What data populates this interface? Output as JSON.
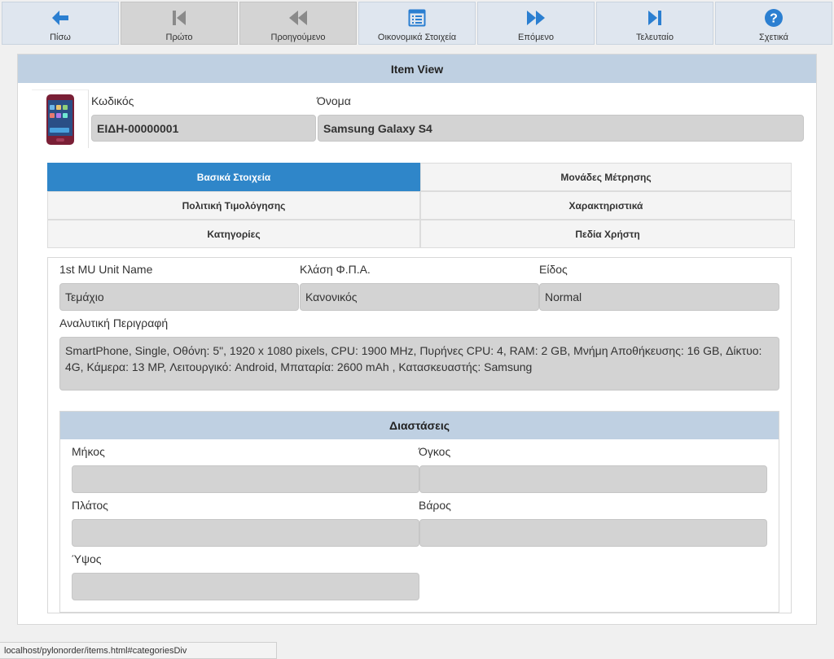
{
  "toolbar": {
    "buttons": [
      {
        "label": "Πίσω",
        "icon": "arrow-left-icon",
        "disabled": false
      },
      {
        "label": "Πρώτο",
        "icon": "skip-first-icon",
        "disabled": true
      },
      {
        "label": "Προηγούμενο",
        "icon": "rewind-icon",
        "disabled": true
      },
      {
        "label": "Οικονομικά Στοιχεία",
        "icon": "document-list-icon",
        "disabled": false
      },
      {
        "label": "Επόμενο",
        "icon": "fast-forward-icon",
        "disabled": false
      },
      {
        "label": "Τελευταίο",
        "icon": "skip-last-icon",
        "disabled": false
      },
      {
        "label": "Σχετικά",
        "icon": "help-icon",
        "disabled": false
      }
    ]
  },
  "panel": {
    "title": "Item View",
    "code_label": "Κωδικός",
    "code_value": "ΕΙΔΗ-00000001",
    "name_label": "Όνομα",
    "name_value": "Samsung Galaxy S4"
  },
  "tabs": [
    {
      "label": "Βασικά Στοιχεία",
      "active": true
    },
    {
      "label": "Μονάδες Μέτρησης",
      "active": false
    },
    {
      "label": "Πολιτική Τιμολόγησης",
      "active": false
    },
    {
      "label": "Χαρακτηριστικά",
      "active": false
    },
    {
      "label": "Κατηγορίες",
      "active": false
    },
    {
      "label": "Πεδία Χρήστη",
      "active": false
    }
  ],
  "basic": {
    "mu_label": "1st MU Unit Name",
    "mu_value": "Τεμάχιο",
    "vat_label": "Κλάση Φ.Π.Α.",
    "vat_value": "Κανονικός",
    "type_label": "Είδος",
    "type_value": "Normal",
    "desc_label": "Αναλυτική Περιγραφή",
    "desc_value": "SmartPhone, Single, Οθόνη: 5\", 1920 x 1080 pixels, CPU: 1900 MHz, Πυρήνες CPU: 4, RAM: 2 GB, Μνήμη Αποθήκευσης: 16 GB, Δίκτυο: 4G, Κάμερα: 13 MP, Λειτουργικό: Android, Μπαταρία: 2600 mAh , Κατασκευαστής: Samsung"
  },
  "dimensions": {
    "title": "Διαστάσεις",
    "length_label": "Μήκος",
    "volume_label": "Όγκος",
    "width_label": "Πλάτος",
    "weight_label": "Βάρος",
    "height_label": "Ύψος"
  },
  "status": {
    "url": "localhost/pylonorder/items.html#categoriesDiv"
  },
  "colors": {
    "accent": "#2f86c9",
    "header_bg": "#bfd0e2",
    "icon_blue": "#2b7fd1",
    "icon_gray": "#8a8a8a"
  }
}
